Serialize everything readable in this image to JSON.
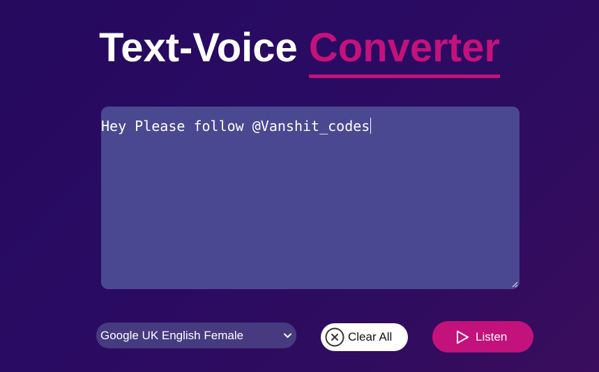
{
  "header": {
    "title_main": "Text-Voice",
    "title_accent": "Converter"
  },
  "editor": {
    "value": "Hey Please follow @Vanshit_codes"
  },
  "controls": {
    "voice_select": {
      "selected": "Google UK English Female",
      "icon": "chevron-down-icon"
    },
    "clear_button": {
      "label": "Clear All",
      "icon": "close-circle-icon"
    },
    "listen_button": {
      "label": "Listen",
      "icon": "play-icon"
    }
  },
  "colors": {
    "background": "#2a0b63",
    "accent": "#c3127c",
    "textarea": "#4b4892",
    "select": "#463b80"
  }
}
